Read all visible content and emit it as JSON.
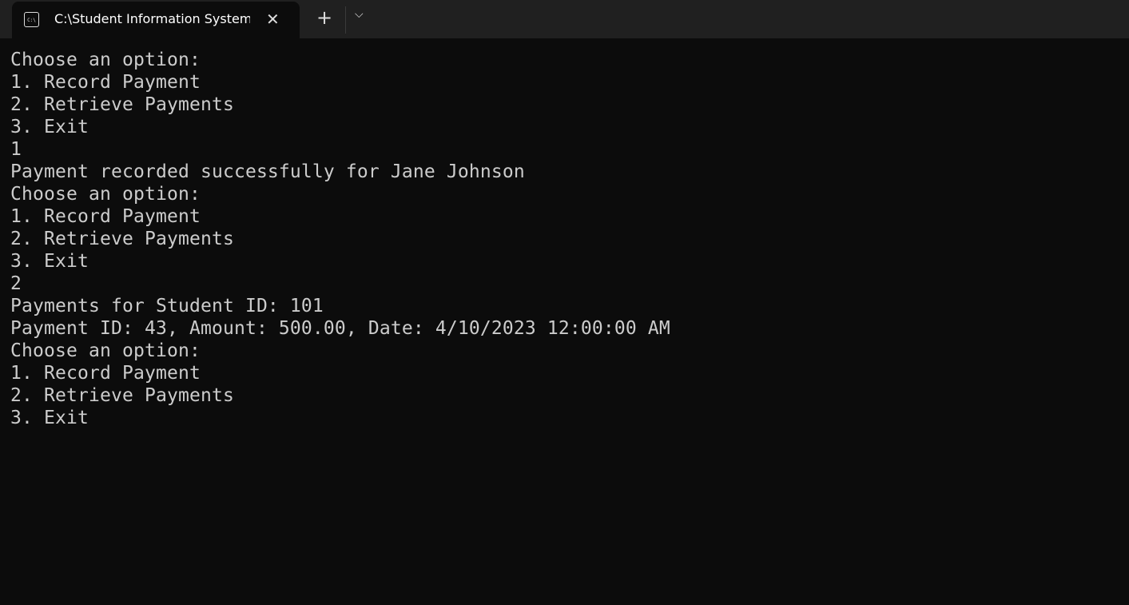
{
  "window": {
    "tab_title": "C:\\Student Information System",
    "tab_icon": "console-icon",
    "tab_icon_text": "C:\\",
    "close_label": "✕",
    "new_tab_label": "+",
    "dropdown_label": "⌵"
  },
  "console": {
    "lines": [
      "Choose an option:",
      "1. Record Payment",
      "2. Retrieve Payments",
      "3. Exit",
      "1",
      "Payment recorded successfully for Jane Johnson",
      "Choose an option:",
      "1. Record Payment",
      "2. Retrieve Payments",
      "3. Exit",
      "2",
      "Payments for Student ID: 101",
      "Payment ID: 43, Amount: 500.00, Date: 4/10/2023 12:00:00 AM",
      "Choose an option:",
      "1. Record Payment",
      "2. Retrieve Payments",
      "3. Exit"
    ]
  }
}
